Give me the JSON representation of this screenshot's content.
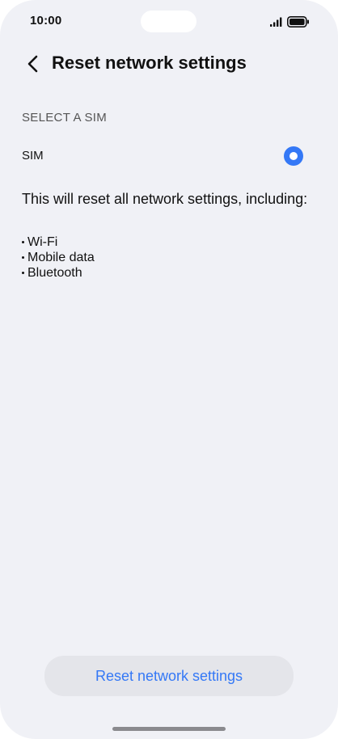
{
  "status_bar": {
    "time": "10:00",
    "signal_icon": "cellular-signal-icon",
    "battery_icon": "battery-full-icon"
  },
  "header": {
    "back_icon": "chevron-left-icon",
    "title": "Reset network settings"
  },
  "sim_section": {
    "label": "SELECT A SIM",
    "sim_option_label": "SIM",
    "sim_selected": true
  },
  "description": {
    "text": "This will reset all network settings, including:",
    "items": [
      "Wi-Fi",
      "Mobile data",
      "Bluetooth"
    ]
  },
  "reset_button": {
    "label": "Reset network settings"
  },
  "colors": {
    "accent": "#3478f6",
    "background": "#f0f1f6",
    "button_background": "#e4e5ea"
  }
}
